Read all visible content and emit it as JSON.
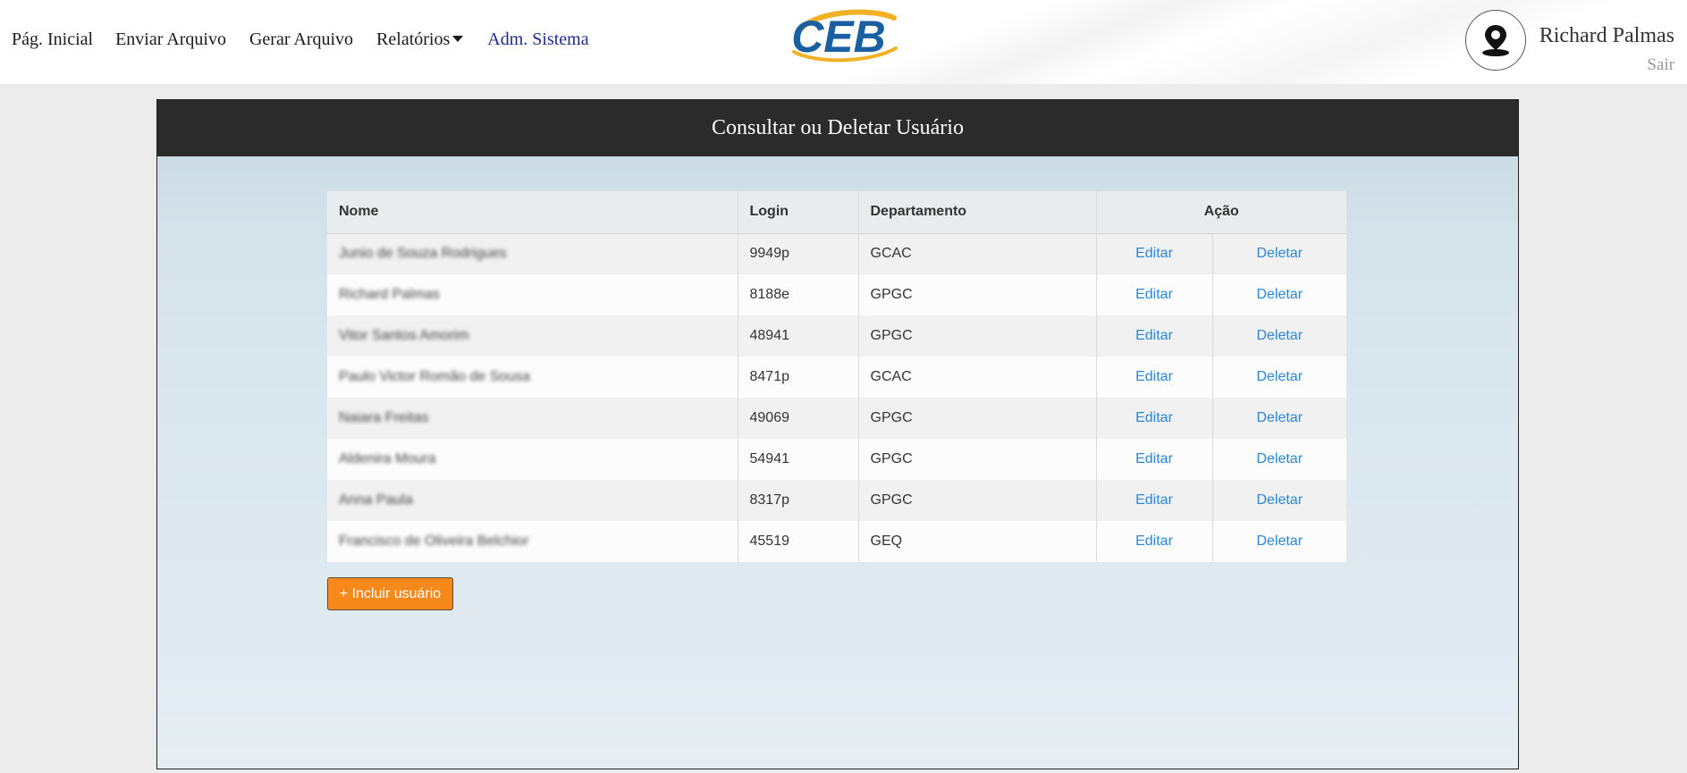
{
  "nav": {
    "home": "Pág. Inicial",
    "upload": "Enviar Arquivo",
    "generate": "Gerar Arquivo",
    "reports": "Relatórios",
    "admin": "Adm. Sistema"
  },
  "logo": {
    "text": "CEB",
    "color": "#1a5fa0",
    "accent": "#f0b224"
  },
  "user": {
    "name": "Richard Palmas",
    "logout": "Sair"
  },
  "panel": {
    "title": "Consultar ou Deletar Usuário"
  },
  "table": {
    "headers": {
      "name": "Nome",
      "login": "Login",
      "dept": "Departamento",
      "action": "Ação"
    },
    "rows": [
      {
        "name": "Junio de Souza Rodrigues",
        "login": "9949p",
        "dept": "GCAC",
        "edit": "Editar",
        "delete": "Deletar"
      },
      {
        "name": "Richard Palmas",
        "login": "8188e",
        "dept": "GPGC",
        "edit": "Editar",
        "delete": "Deletar"
      },
      {
        "name": "Vitor Santos Amorim",
        "login": "48941",
        "dept": "GPGC",
        "edit": "Editar",
        "delete": "Deletar"
      },
      {
        "name": "Paulo Victor Romão de Sousa",
        "login": "8471p",
        "dept": "GCAC",
        "edit": "Editar",
        "delete": "Deletar"
      },
      {
        "name": "Naiara Freitas",
        "login": "49069",
        "dept": "GPGC",
        "edit": "Editar",
        "delete": "Deletar"
      },
      {
        "name": "Aldenira Moura",
        "login": "54941",
        "dept": "GPGC",
        "edit": "Editar",
        "delete": "Deletar"
      },
      {
        "name": "Anna Paula",
        "login": "8317p",
        "dept": "GPGC",
        "edit": "Editar",
        "delete": "Deletar"
      },
      {
        "name": "Francisco de Oliveira Belchior",
        "login": "45519",
        "dept": "GEQ",
        "edit": "Editar",
        "delete": "Deletar"
      }
    ]
  },
  "add_button": "+ Incluir usuário"
}
